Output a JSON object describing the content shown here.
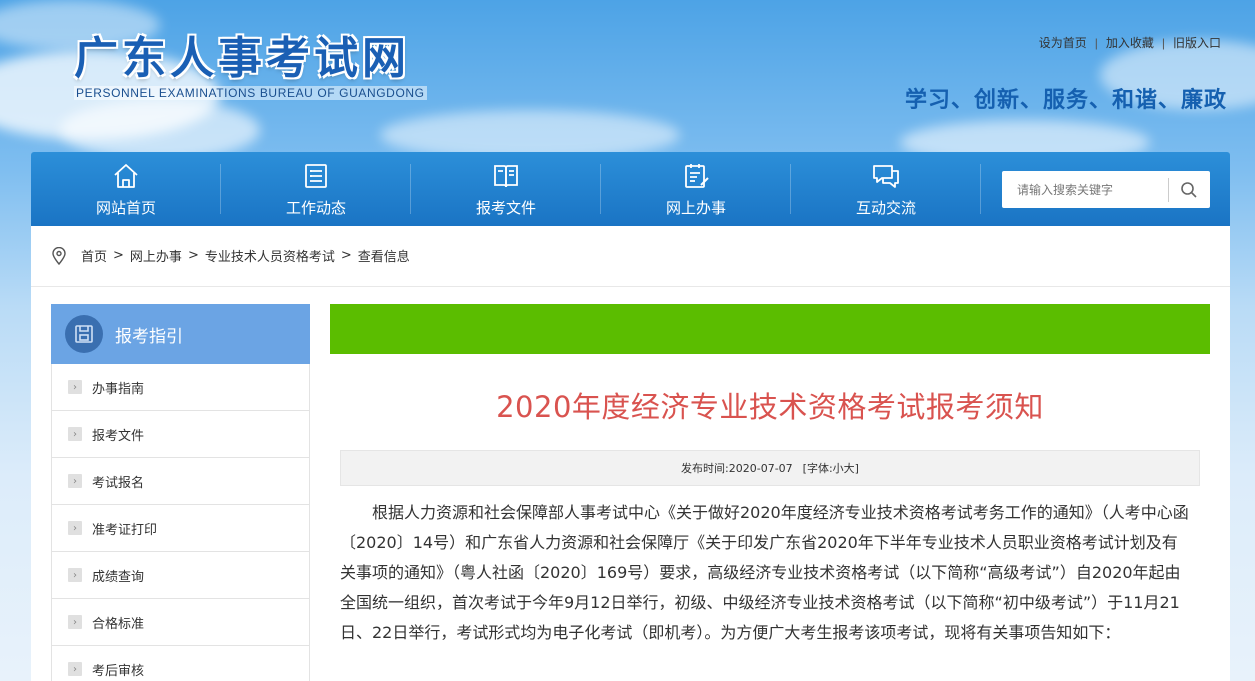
{
  "header": {
    "logo_cn": "广东人事考试网",
    "logo_en": "PERSONNEL EXAMINATIONS BUREAU OF GUANGDONG",
    "top_links": [
      "设为首页",
      "加入收藏",
      "旧版入口"
    ],
    "slogan": "学习、创新、服务、和谐、廉政"
  },
  "nav": {
    "items": [
      {
        "label": "网站首页",
        "icon": "home-icon"
      },
      {
        "label": "工作动态",
        "icon": "news-icon"
      },
      {
        "label": "报考文件",
        "icon": "book-icon"
      },
      {
        "label": "网上办事",
        "icon": "clipboard-icon"
      },
      {
        "label": "互动交流",
        "icon": "chat-icon"
      }
    ],
    "search_placeholder": "请输入搜索关键字"
  },
  "breadcrumb": [
    "首页",
    "网上办事",
    "专业技术人员资格考试",
    "查看信息"
  ],
  "sidebar": {
    "title": "报考指引",
    "items": [
      "办事指南",
      "报考文件",
      "考试报名",
      "准考证打印",
      "成绩查询",
      "合格标准",
      "考后审核"
    ]
  },
  "article": {
    "title": "2020年度经济专业技术资格考试报考须知",
    "publish_label": "发布时间:",
    "publish_date": "2020-07-07",
    "font_label": "[字体:",
    "font_small": "小",
    "font_big": "大]",
    "body": "根据人力资源和社会保障部人事考试中心《关于做好2020年度经济专业技术资格考试考务工作的通知》（人考中心函〔2020〕14号）和广东省人力资源和社会保障厅《关于印发广东省2020年下半年专业技术人员职业资格考试计划及有关事项的通知》（粤人社函〔2020〕169号）要求，高级经济专业技术资格考试（以下简称“高级考试”）自2020年起由全国统一组织，首次考试于今年9月12日举行，初级、中级经济专业技术资格考试（以下简称“初中级考试”）于11月21日、22日举行，考试形式均为电子化考试（即机考）。为方便广大考生报考该项考试，现将有关事项告知如下："
  },
  "colors": {
    "nav_blue": "#1a74c4",
    "green_bar": "#5bbd00",
    "title_red": "#d9534f",
    "sidebar_head": "#6ba4e4"
  }
}
